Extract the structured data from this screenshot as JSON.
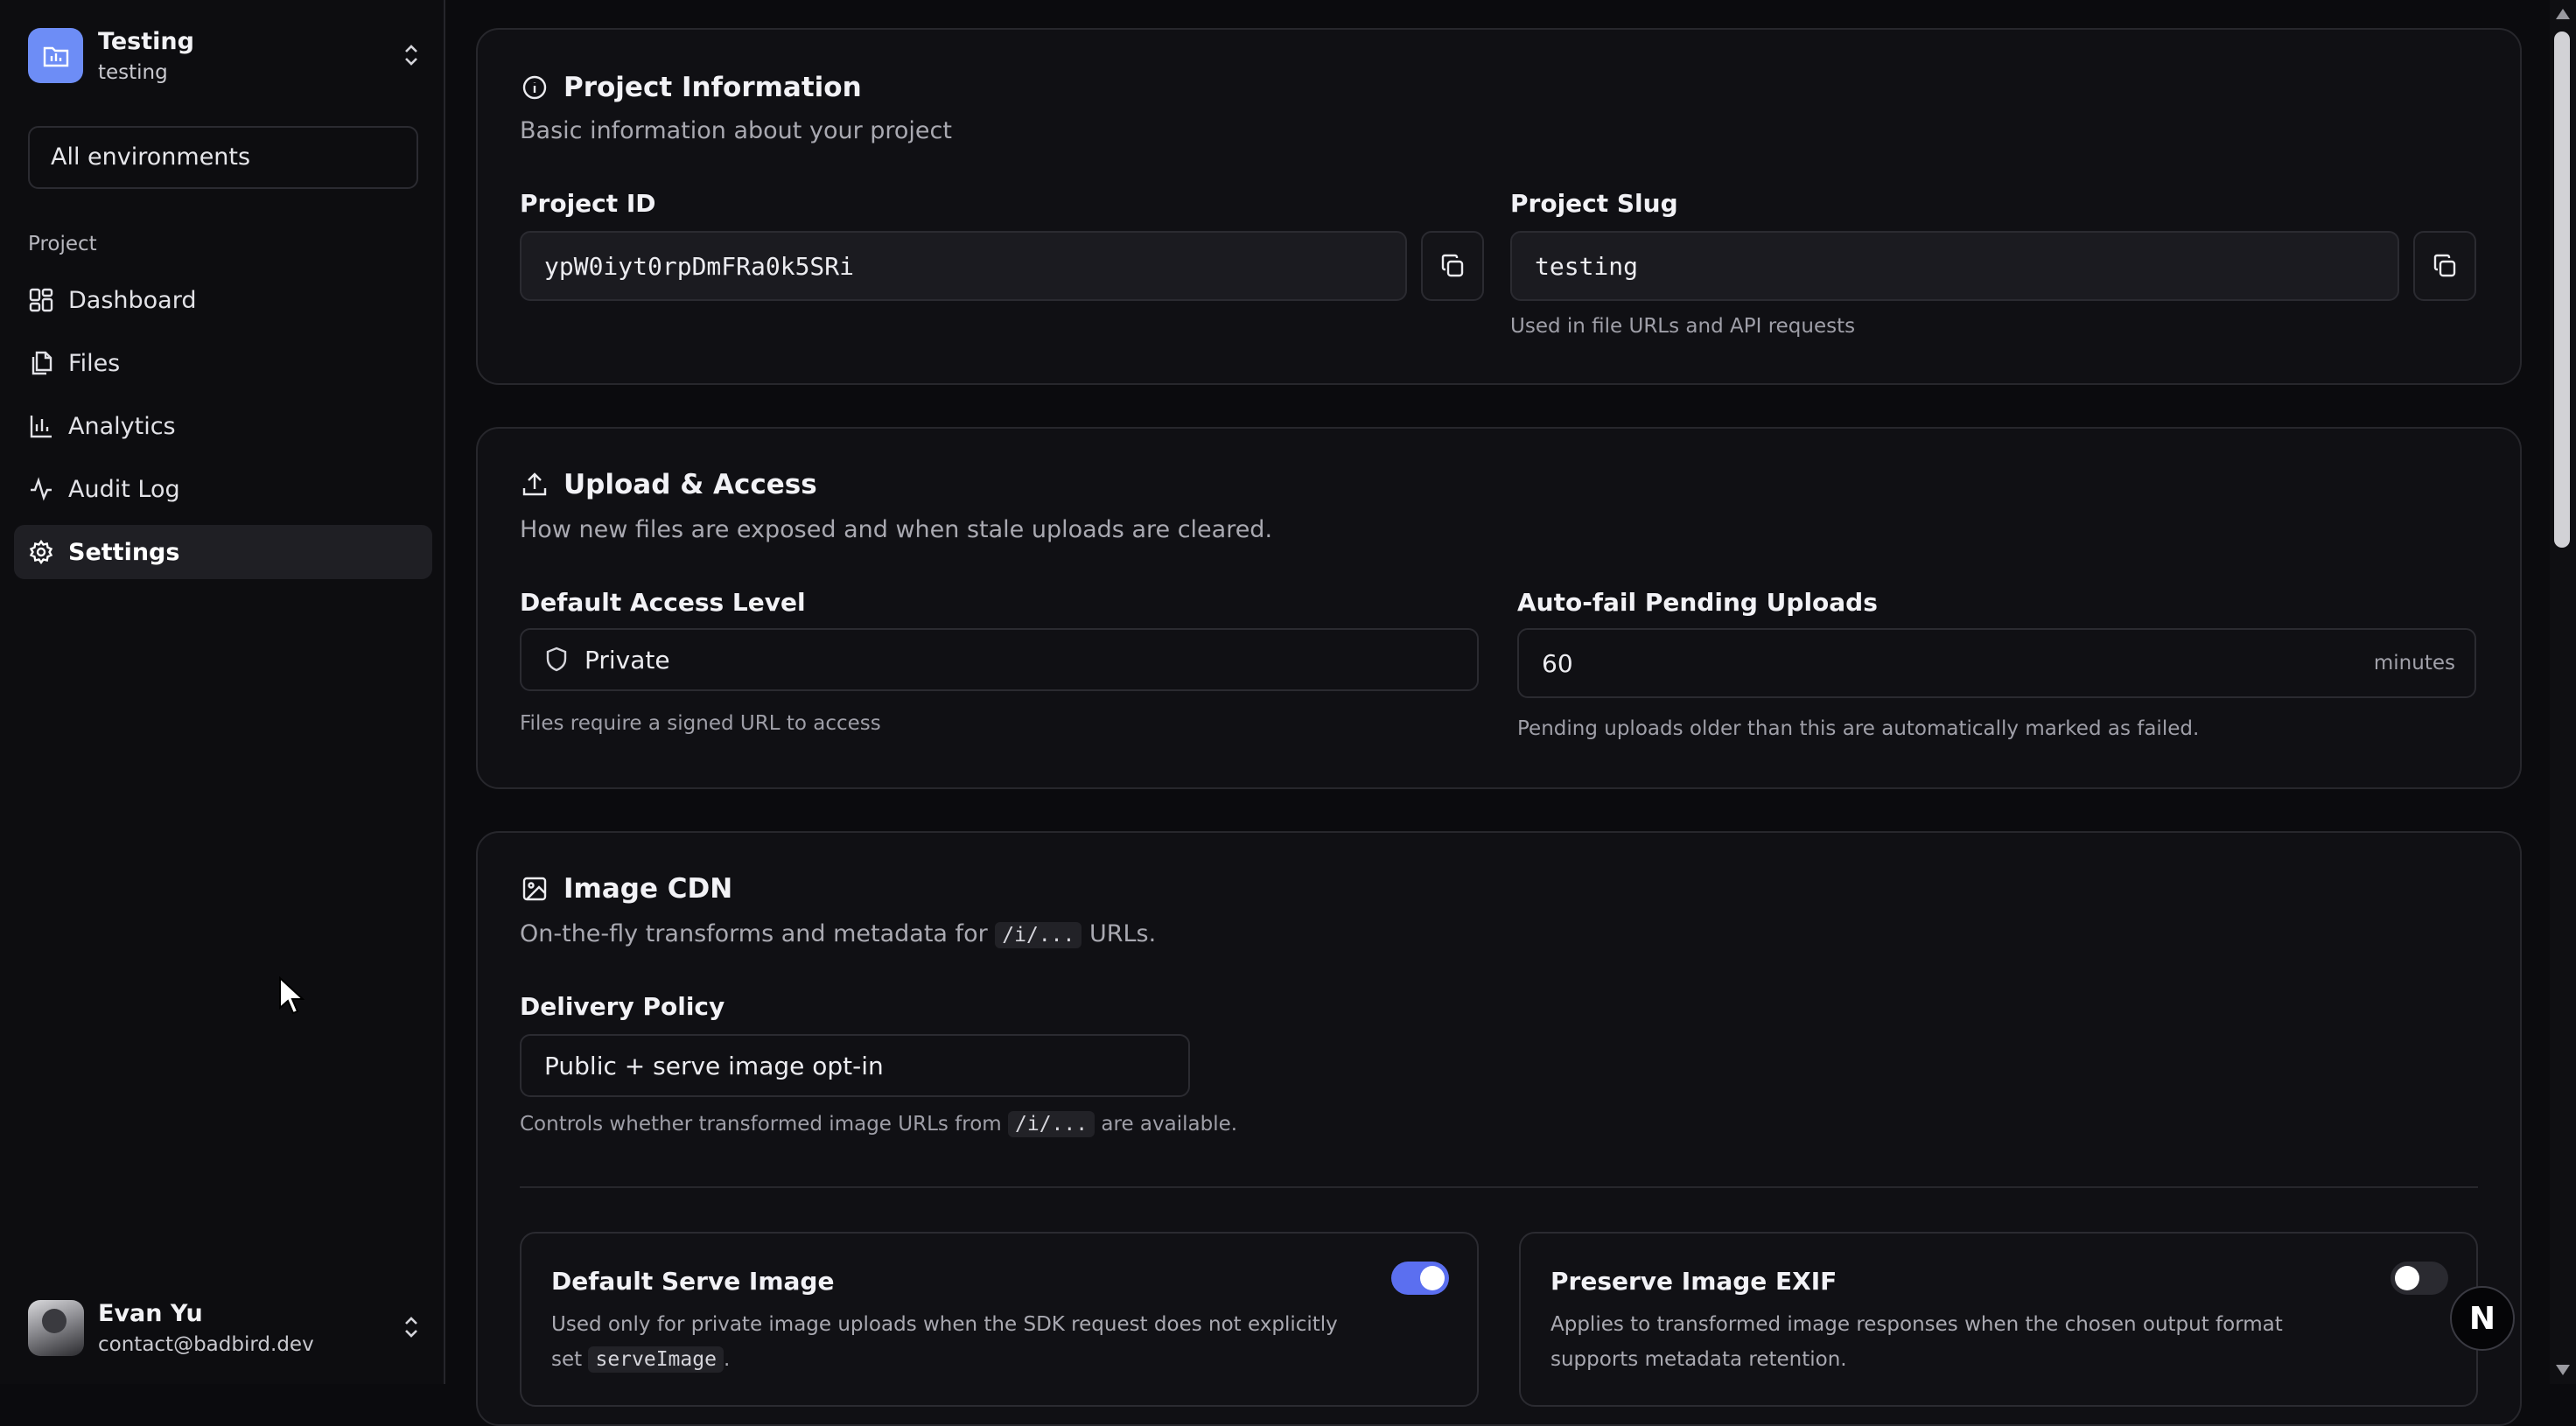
{
  "sidebar": {
    "project_name": "Testing",
    "project_slug": "testing",
    "env_select": "All environments",
    "section_label": "Project",
    "items": [
      {
        "label": "Dashboard",
        "icon": "dashboard-icon"
      },
      {
        "label": "Files",
        "icon": "files-icon"
      },
      {
        "label": "Analytics",
        "icon": "analytics-icon"
      },
      {
        "label": "Audit Log",
        "icon": "activity-icon"
      },
      {
        "label": "Settings",
        "icon": "gear-icon",
        "active": true
      }
    ],
    "user": {
      "name": "Evan Yu",
      "email": "contact@badbird.dev"
    }
  },
  "project_info": {
    "title": "Project Information",
    "description": "Basic information about your project",
    "id_label": "Project ID",
    "id_value": "ypW0iyt0rpDmFRa0k5SRi",
    "slug_label": "Project Slug",
    "slug_value": "testing",
    "slug_hint": "Used in file URLs and API requests"
  },
  "upload_access": {
    "title": "Upload & Access",
    "description": "How new files are exposed and when stale uploads are cleared.",
    "access_label": "Default Access Level",
    "access_value": "Private",
    "access_hint": "Files require a signed URL to access",
    "autofail_label": "Auto-fail Pending Uploads",
    "autofail_value": "60",
    "autofail_unit": "minutes",
    "autofail_hint": "Pending uploads older than this are automatically marked as failed."
  },
  "image_cdn": {
    "title": "Image CDN",
    "description_prefix": "On-the-fly transforms and metadata for",
    "description_code": "/i/...",
    "description_suffix": "URLs.",
    "policy_label": "Delivery Policy",
    "policy_value": "Public + serve image opt-in",
    "policy_hint_prefix": "Controls whether transformed image URLs from",
    "policy_hint_code": "/i/...",
    "policy_hint_suffix": "are available.",
    "serve_title": "Default Serve Image",
    "serve_desc": "Used only for private image uploads when the SDK request does not explicitly set",
    "serve_code": "serveImage",
    "serve_desc_end": ".",
    "serve_enabled": true,
    "exif_title": "Preserve Image EXIF",
    "exif_desc": "Applies to transformed image responses when the chosen output format supports metadata retention.",
    "exif_enabled": false
  },
  "badge": {
    "letter": "N"
  },
  "colors": {
    "accent": "#5b6ff0",
    "logo": "#6d8df6",
    "background": "#0b0b0e"
  }
}
